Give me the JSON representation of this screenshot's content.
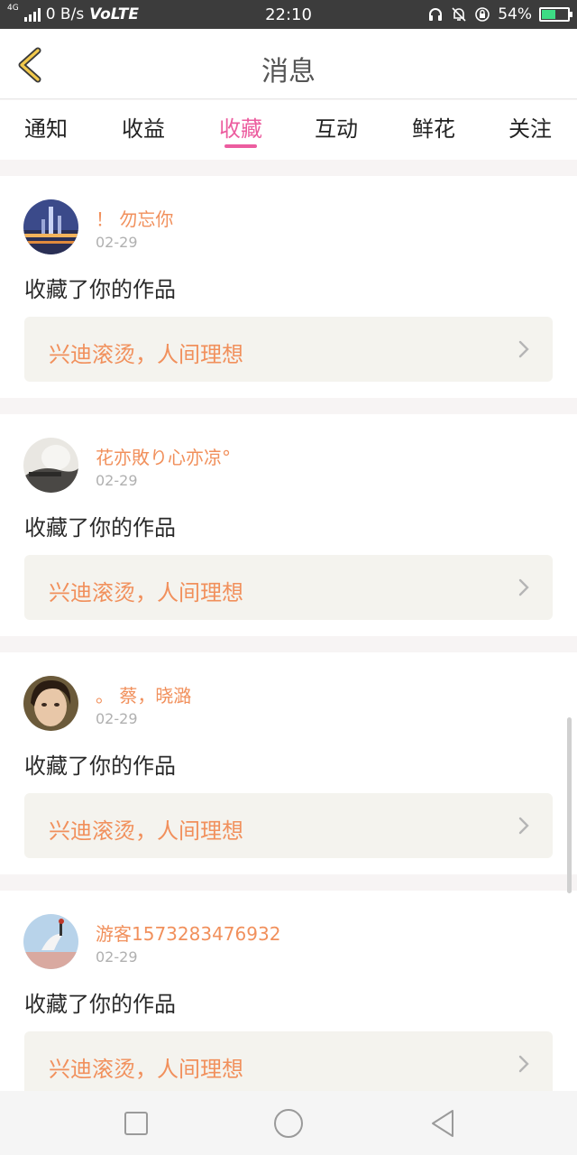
{
  "status_bar": {
    "network": "4G",
    "speed": "0 B/s",
    "volte": "VoLTE",
    "time": "22:10",
    "battery_percent": "54%",
    "battery_level": 0.54
  },
  "header": {
    "title": "消息"
  },
  "tabs": [
    {
      "label": "通知",
      "active": false
    },
    {
      "label": "收益",
      "active": false
    },
    {
      "label": "收藏",
      "active": true
    },
    {
      "label": "互动",
      "active": false
    },
    {
      "label": "鲜花",
      "active": false
    },
    {
      "label": "关注",
      "active": false
    }
  ],
  "messages": [
    {
      "user": "！ 勿忘你",
      "date": "02-29",
      "action": "收藏了你的作品",
      "work_title": "兴迪滚烫，人间理想"
    },
    {
      "user": "花亦敗り心亦凉°",
      "date": "02-29",
      "action": "收藏了你的作品",
      "work_title": "兴迪滚烫，人间理想"
    },
    {
      "user": "。 蔡，晓潞",
      "date": "02-29",
      "action": "收藏了你的作品",
      "work_title": "兴迪滚烫，人间理想"
    },
    {
      "user": "游客1573283476932",
      "date": "02-29",
      "action": "收藏了你的作品",
      "work_title": "兴迪滚烫，人间理想"
    }
  ],
  "colors": {
    "accent": "#ec5d9f",
    "username": "#f1905c",
    "work_bg": "#f4f3ee"
  },
  "icons": {
    "back": "chevron-left-icon",
    "work_arrow": "chevron-right-icon",
    "nav": [
      "square-icon",
      "circle-icon",
      "triangle-back-icon"
    ]
  }
}
